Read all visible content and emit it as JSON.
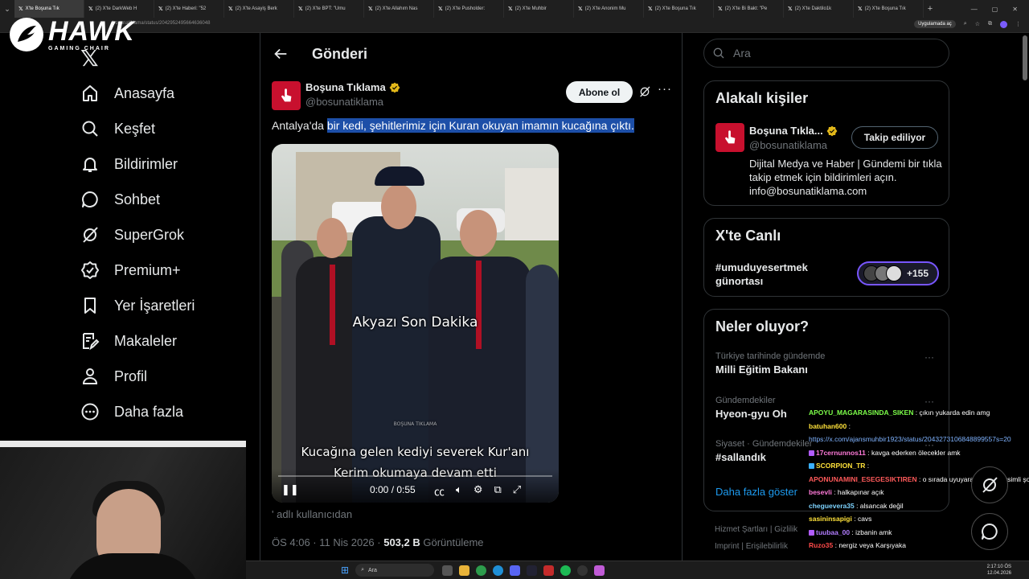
{
  "browser": {
    "tabs": [
      {
        "label": "X'te Boşuna Tık",
        "active": true
      },
      {
        "label": "(2) X'te DarkWeb H"
      },
      {
        "label": "(2) X'te Haberi: \"52"
      },
      {
        "label": "(2) X'te Asayiş Berk"
      },
      {
        "label": "(2) X'te BPT: \"Umu"
      },
      {
        "label": "(2) X'te Allahım Nas"
      },
      {
        "label": "(2) X'te Pusholder:"
      },
      {
        "label": "(2) X'te Muhbir"
      },
      {
        "label": "(2) X'te Anonim Mu"
      },
      {
        "label": "(2) X'te Boşuna Tık"
      },
      {
        "label": "(2) X'te Bi Bakt: \"Pe"
      },
      {
        "label": "(2) X'te Daktilo1k"
      },
      {
        "label": "(2) X'te Boşuna Tık"
      }
    ],
    "url": "bosunatiklama/status/2042952495664636048",
    "open_in_app": "Uygulamada aç"
  },
  "overlay_logo": {
    "main": "HAWK",
    "sub": "GAMING CHAIR"
  },
  "nav": {
    "items": [
      {
        "label": "Anasayfa",
        "icon": "home-icon"
      },
      {
        "label": "Keşfet",
        "icon": "search-icon"
      },
      {
        "label": "Bildirimler",
        "icon": "bell-icon"
      },
      {
        "label": "Sohbet",
        "icon": "chat-icon"
      },
      {
        "label": "SuperGrok",
        "icon": "grok-icon"
      },
      {
        "label": "Premium+",
        "icon": "verified-icon"
      },
      {
        "label": "Yer İşaretleri",
        "icon": "bookmark-icon"
      },
      {
        "label": "Makaleler",
        "icon": "article-icon"
      },
      {
        "label": "Profil",
        "icon": "person-icon"
      },
      {
        "label": "Daha fazla",
        "icon": "more-circle-icon"
      }
    ]
  },
  "main": {
    "title": "Gönderi",
    "post": {
      "author_name": "Boşuna Tıklama",
      "author_handle": "@bosunatiklama",
      "subscribe_label": "Abone ol",
      "text_prefix": "Antalya'da ",
      "text_highlight": "bir kedi, şehitlerimiz için Kuran okuyan imamın kucağına çıktı.",
      "video": {
        "overlay_title": "Akyazı Son Dakika",
        "watermark": "BOŞUNA TIKLAMA",
        "caption_line1": "Kucağına gelen kediyi severek Kur'anı",
        "caption_line2": "Kerim okumaya devam etti",
        "time": "0:00 / 0:55",
        "progress": 0
      },
      "posted_by": "adlı kullanıcıdan",
      "timestamp": "ÖS 4:06 · 11 Nis 2026 · ",
      "views_value": "503,2 B",
      "views_label": " Görüntüleme"
    }
  },
  "right": {
    "search_placeholder": "Ara",
    "related": {
      "title": "Alakalı kişiler",
      "name": "Boşuna Tıkla...",
      "handle": "@bosunatiklama",
      "follow_label": "Takip ediliyor",
      "bio": "Dijital Medya ve Haber | Gündemi bir tıkla takip etmek için bildirimleri açın. info@bosunatiklama.com"
    },
    "live": {
      "title": "X'te Canlı",
      "tag": "#umuduyesertmek günortası",
      "count": "+155"
    },
    "trends": {
      "title": "Neler oluyor?",
      "items": [
        {
          "context": "Türkiye tarihinde gündemde",
          "name": "Milli Eğitim Bakanı"
        },
        {
          "context": "Gündemdekiler",
          "name": "Hyeon-gyu Oh"
        },
        {
          "context": "Siyaset · Gündemdekiler",
          "name": "#sallandık"
        }
      ],
      "show_more": "Daha fazla göster"
    },
    "footer": {
      "line1": "Hizmet Şartları  |  Gizlilik",
      "line2": "Imprint  |  Erişilebilirlik"
    }
  },
  "chat": [
    {
      "user": "APOYU_MAGARASINDA_SIKEN",
      "color": "#7dff4a",
      "msg": " : çıkın yukarda edin amg"
    },
    {
      "user": "batuhan600",
      "color": "#ffe23a",
      "msg": " :"
    },
    {
      "user": "",
      "color": "#7fb3ff",
      "msg": "https://x.com/ajansmuhbir1923/status/2043273106848899557s=20",
      "link": true
    },
    {
      "user": "17cernunnos11",
      "color": "#ff7ad9",
      "msg": " : kavga ederken ölecekler amk",
      "badge": "#b25cff"
    },
    {
      "user": "SCORPION_TR",
      "color": "#ffe23a",
      "msg": " : ",
      "badge": "#3ab0ff"
    },
    {
      "user": "APONUNAMINI_ESEGESIKTIREN",
      "color": "#ff5a5a",
      "msg": " : o sırada uyuyarak gelen dersimli şoför"
    },
    {
      "user": "besevli",
      "color": "#ff7ad9",
      "msg": " : halkapınar açık"
    },
    {
      "user": "cheguevera35",
      "color": "#7dd3ff",
      "msg": " : alsancak değil"
    },
    {
      "user": "sasininsapigi",
      "color": "#ffe23a",
      "msg": " : cavs"
    },
    {
      "user": "tuubaa_00",
      "color": "#b27dff",
      "msg": " : izbanin amk",
      "badge": "#b25cff"
    },
    {
      "user": "Ruzo35",
      "color": "#ff4a4a",
      "msg": " : nergiz veya Karşıyaka"
    }
  ],
  "taskbar": {
    "search_placeholder": "Ara",
    "time": "2:17:10 ÖS",
    "date": "12.04.2026"
  }
}
